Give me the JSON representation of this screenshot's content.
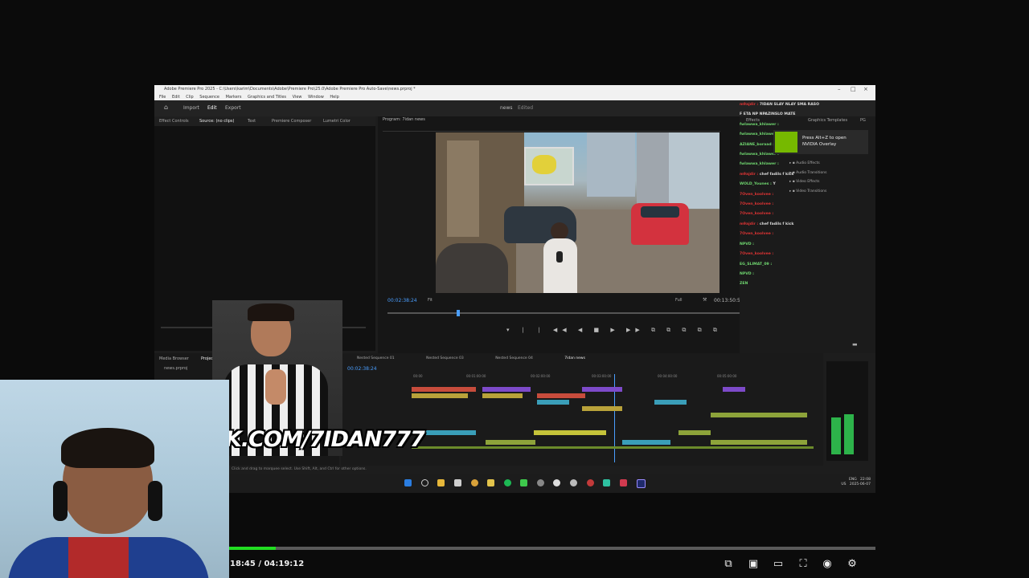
{
  "premiere": {
    "title": "Adobe Premiere Pro 2025 - C:\\Users\\karim\\Documents\\Adobe\\Premiere Pro\\25.0\\Adobe Premiere Pro Auto-Save\\news.prproj *",
    "menu": [
      "File",
      "Edit",
      "Clip",
      "Sequence",
      "Markers",
      "Graphics and Titles",
      "View",
      "Window",
      "Help"
    ],
    "header": {
      "import": "Import",
      "edit": "Edit",
      "export": "Export",
      "project_name": "news",
      "status": "Edited"
    },
    "panel_tabs": [
      "Effect Controls",
      "Source: (no clips)",
      "Text",
      "Premiere Composer",
      "Lumetri Color"
    ],
    "program_tab": "Program: 7idan news",
    "program_timecode": "00:02:38:24",
    "program_duration": "00:13:50:58",
    "fit_label": "Full",
    "fit_left": "Fit",
    "effects_items": [
      "Audio Effects",
      "Audio Transitions",
      "Video Effects",
      "Video Transitions"
    ],
    "right_tabs": [
      "Effects",
      "Graphics Templates",
      "PG"
    ],
    "project_tabs": [
      "Media Browser",
      "Project: news"
    ],
    "project_file": "news.prproj",
    "sequence_tabs": [
      "Nested Sequence 01",
      "Nested Sequence 03",
      "Nested Sequence 04",
      "7idan news"
    ],
    "timeline_timecode": "00:02:38:24",
    "ruler_labels": [
      "00:00",
      "00:01:00:00",
      "00:02:00:00",
      "00:03:00:00",
      "00:04:00:00",
      "00:05:00:00"
    ],
    "status_text": "Click and drag to marquee select. Use Shift, Alt, and Ctrl for other options.",
    "tray": {
      "lang": "ENG",
      "region": "US",
      "time": "22:08",
      "date": "2025-06-07"
    }
  },
  "nvidia": {
    "line1": "Press Alt+Z to open",
    "line2": "NVIDIA Overlay"
  },
  "chat": [
    {
      "user": "m9ajdir :",
      "msg": "7IDAN SLAY NLAY SMA RASO F ETA NP NPAZINSLO MATE",
      "color": "red"
    },
    {
      "user": "fwlawwa_khlawer :",
      "msg": "",
      "color": "green"
    },
    {
      "user": "fwlawwa_khlawer :",
      "msg": "",
      "color": "green"
    },
    {
      "user": "AZIANE_boraad :",
      "msg": "",
      "color": "green"
    },
    {
      "user": "fwlawwa_khlawer :",
      "msg": "",
      "color": "green"
    },
    {
      "user": "fwlawwa_khlawer :",
      "msg": "",
      "color": "green"
    },
    {
      "user": "m9ajdir :",
      "msg": "chef fadils f kick",
      "color": "red"
    },
    {
      "user": "WOLD_Younes :",
      "msg": "Y",
      "color": "green"
    },
    {
      "user": "7Oven_koolvee :",
      "msg": "",
      "color": "red"
    },
    {
      "user": "7Oven_koolvee :",
      "msg": "",
      "color": "red"
    },
    {
      "user": "7Oven_koolvee :",
      "msg": "",
      "color": "red"
    },
    {
      "user": "m9ajdir :",
      "msg": "chef fadils f kick",
      "color": "red"
    },
    {
      "user": "7Oven_koolvee :",
      "msg": "",
      "color": "red"
    },
    {
      "user": "NPVD :",
      "msg": "",
      "color": "green"
    },
    {
      "user": "7Oven_koolvee :",
      "msg": "",
      "color": "red"
    },
    {
      "user": "EG_SLIMAT_09 :",
      "msg": "",
      "color": "green"
    },
    {
      "user": "NPVD :",
      "msg": "",
      "color": "green"
    },
    {
      "user": "ZEN",
      "msg": "",
      "color": "green"
    }
  ],
  "overlay": {
    "kick_text": "K.COM/7IDAN777"
  },
  "player": {
    "time": "18:45 / 04:19:12",
    "progress": 0.072,
    "controls": [
      "miniplayer-icon",
      "theater-icon",
      "screen-icon",
      "fullscreen-icon",
      "autoplay-icon",
      "settings-icon"
    ]
  }
}
